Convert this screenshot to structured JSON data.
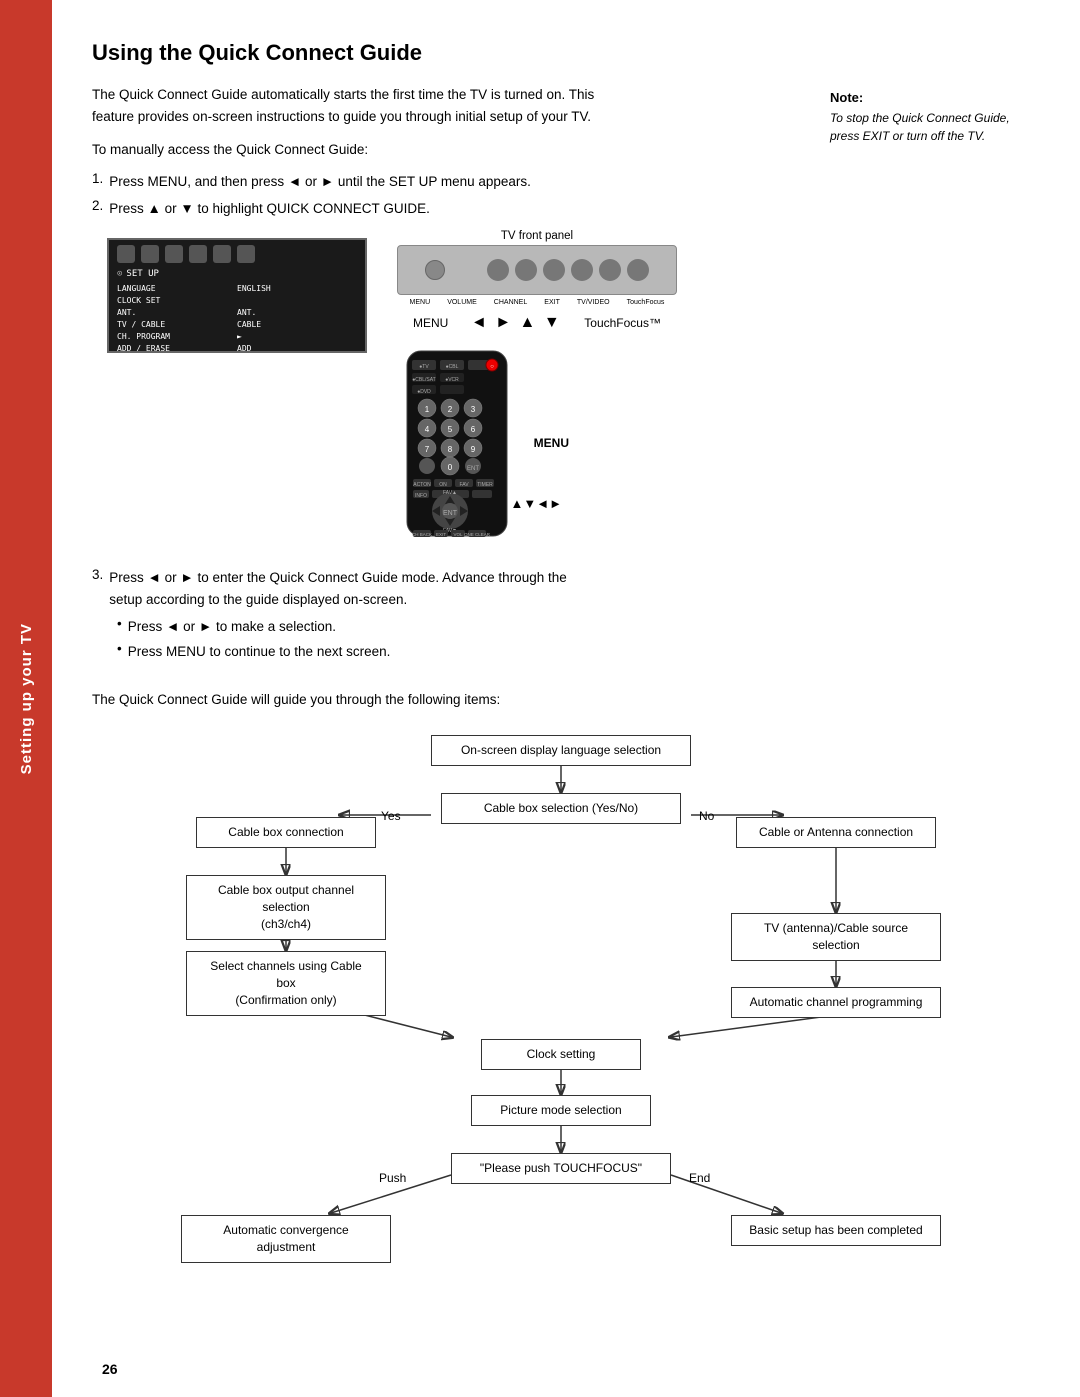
{
  "page": {
    "number": "26",
    "sidebar_label": "Setting up your TV"
  },
  "title": "Using the Quick Connect Guide",
  "intro": {
    "paragraph1": "The Quick Connect Guide automatically starts the first time the TV is turned on. This feature provides on-screen instructions to guide you through initial setup of your TV.",
    "paragraph2": "To manually access the Quick Connect Guide:"
  },
  "steps": [
    {
      "num": "1",
      "text": "Press MENU, and then press ◄ or ► until the SET UP menu appears."
    },
    {
      "num": "2",
      "text": "Press ▲ or ▼ to highlight QUICK CONNECT GUIDE."
    }
  ],
  "note": {
    "title": "Note:",
    "content": "To stop the Quick Connect Guide, press EXIT or turn off the TV."
  },
  "tv_front_panel_label": "TV front panel",
  "menu_label": "MENU",
  "touchfocus_label": "TouchFocus™",
  "step3": {
    "main": "Press ◄ or ► to enter the Quick Connect Guide mode. Advance through the setup according to the guide displayed on-screen.",
    "bullet1": "Press ◄ or ► to make a selection.",
    "bullet2": "Press MENU to continue to the next screen."
  },
  "remote_label_menu": "MENU",
  "remote_label_arrows": "▲▼◄►",
  "flowchart": {
    "intro": "The Quick Connect Guide will guide you through the following items:",
    "boxes": {
      "lang_select": "On-screen display language selection",
      "cable_box_select": "Cable box selection (Yes/No)",
      "yes_label": "Yes",
      "no_label": "No",
      "cable_box_conn": "Cable box connection",
      "cable_antenna_conn": "Cable or Antenna connection",
      "cable_box_output": "Cable box output channel selection\n(ch3/ch4)",
      "tv_antenna_source": "TV (antenna)/Cable source selection",
      "select_channels": "Select channels using Cable box\n(Confirmation only)",
      "auto_channel": "Automatic channel programming",
      "clock_setting": "Clock setting",
      "picture_mode": "Picture mode selection",
      "please_push": "\"Please push TOUCHFOCUS\"",
      "auto_convergence": "Automatic convergence adjustment",
      "basic_setup": "Basic setup has been completed",
      "push_label": "Push",
      "end_label": "End"
    }
  }
}
